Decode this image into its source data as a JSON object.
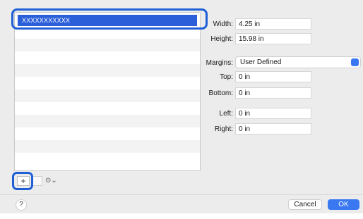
{
  "list": {
    "selected_item": "XXXXXXXXXXX",
    "row_count": 12
  },
  "buttons": {
    "add": "+",
    "action_menu": "⊙⌄",
    "help": "?",
    "cancel": "Cancel",
    "ok": "OK"
  },
  "paper": {
    "width_label": "Width:",
    "width_value": "4.25 in",
    "height_label": "Height:",
    "height_value": "15.98 in"
  },
  "margins": {
    "label": "Margins:",
    "selected": "User Defined",
    "top_label": "Top:",
    "top_value": "0 in",
    "bottom_label": "Bottom:",
    "bottom_value": "0 in",
    "left_label": "Left:",
    "left_value": "0 in",
    "right_label": "Right:",
    "right_value": "0 in"
  },
  "colors": {
    "accent": "#3a78f2",
    "selection": "#2b5fd9",
    "highlight_outline": "#1f5fd6"
  }
}
